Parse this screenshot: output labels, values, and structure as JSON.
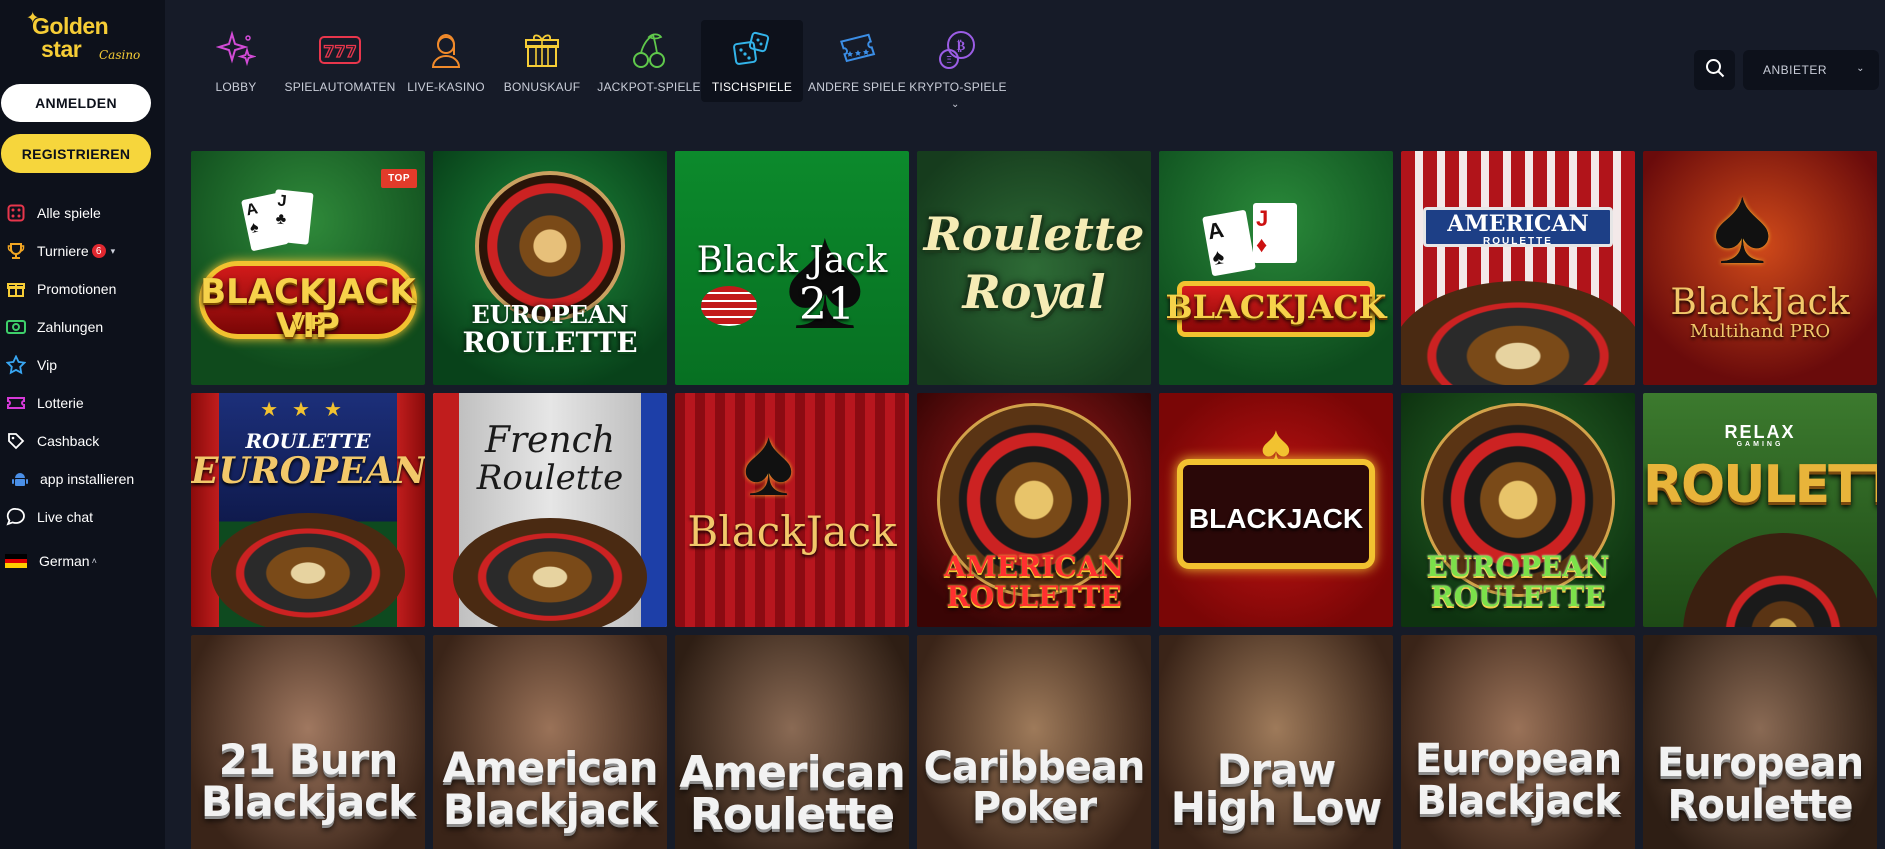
{
  "brand": {
    "line1": "Golden",
    "line2": "star",
    "script": "Casino"
  },
  "auth": {
    "login_label": "ANMELDEN",
    "register_label": "REGISTRIEREN"
  },
  "sidebar": {
    "items": [
      {
        "label": "Alle spiele",
        "icon": "dice-icon"
      },
      {
        "label": "Turniere",
        "icon": "trophy-icon",
        "badge": "6"
      },
      {
        "label": "Promotionen",
        "icon": "gift-icon"
      },
      {
        "label": "Zahlungen",
        "icon": "cash-icon"
      },
      {
        "label": "Vip",
        "icon": "star-icon"
      },
      {
        "label": "Lotterie",
        "icon": "ticket-icon"
      },
      {
        "label": "Cashback",
        "icon": "tag-icon"
      },
      {
        "label": "app installieren",
        "icon": "android-icon"
      },
      {
        "label": "Live chat",
        "icon": "chat-icon"
      }
    ],
    "language": "German"
  },
  "categories": [
    {
      "label": "LOBBY",
      "icon": "sparkle-icon"
    },
    {
      "label": "SPIELAUTOMATEN",
      "icon": "slot-777-icon"
    },
    {
      "label": "LIVE-KASINO",
      "icon": "dealer-icon"
    },
    {
      "label": "BONUSKAUF",
      "icon": "gift-box-icon"
    },
    {
      "label": "JACKPOT-SPIELE",
      "icon": "cherry-icon"
    },
    {
      "label": "TISCHSPIELE",
      "icon": "dice-pair-icon",
      "active": true
    },
    {
      "label": "ANDERE SPIELE",
      "icon": "ticket-stars-icon"
    },
    {
      "label": "KRYPTO-SPIELE",
      "icon": "crypto-coin-icon"
    }
  ],
  "search": {
    "icon": "search-icon"
  },
  "provider_select": {
    "label": "ANBIETER"
  },
  "games": {
    "row1": [
      {
        "title": "BLACKJACK VIP",
        "tag": "TOP"
      },
      {
        "title_a": "EUROPEAN",
        "title_b": "ROULETTE"
      },
      {
        "title_a": "Black Jack",
        "title_b": "21"
      },
      {
        "title_a": "Roulette",
        "title_b": "Royal"
      },
      {
        "title": "BLACKJACK"
      },
      {
        "title_a": "AMERICAN",
        "title_b": "ROULETTE"
      },
      {
        "title_a": "BlackJack",
        "title_b": "Multihand PRO"
      }
    ],
    "row2": [
      {
        "title_a": "ROULETTE",
        "title_b": "EUROPEAN"
      },
      {
        "title_a": "French",
        "title_b": "Roulette"
      },
      {
        "title": "BlackJack"
      },
      {
        "title_a": "AMERICAN",
        "title_b": "ROULETTE"
      },
      {
        "title": "BLACKJACK"
      },
      {
        "title_a": "EUROPEAN",
        "title_b": "ROULETTE"
      },
      {
        "title_a": "RELAX",
        "title_b": "ROULETTE",
        "small": "GAMING"
      }
    ],
    "row3": [
      {
        "title_a": "21 Burn",
        "title_b": "Blackjack"
      },
      {
        "title_a": "American",
        "title_b": "Blackjack"
      },
      {
        "title_a": "American",
        "title_b": "Roulette"
      },
      {
        "title_a": "Caribbean",
        "title_b": "Poker"
      },
      {
        "title_a": "Draw",
        "title_b": "High Low"
      },
      {
        "title_a": "European",
        "title_b": "Blackjack"
      },
      {
        "title_a": "European",
        "title_b": "Roulette"
      }
    ]
  }
}
